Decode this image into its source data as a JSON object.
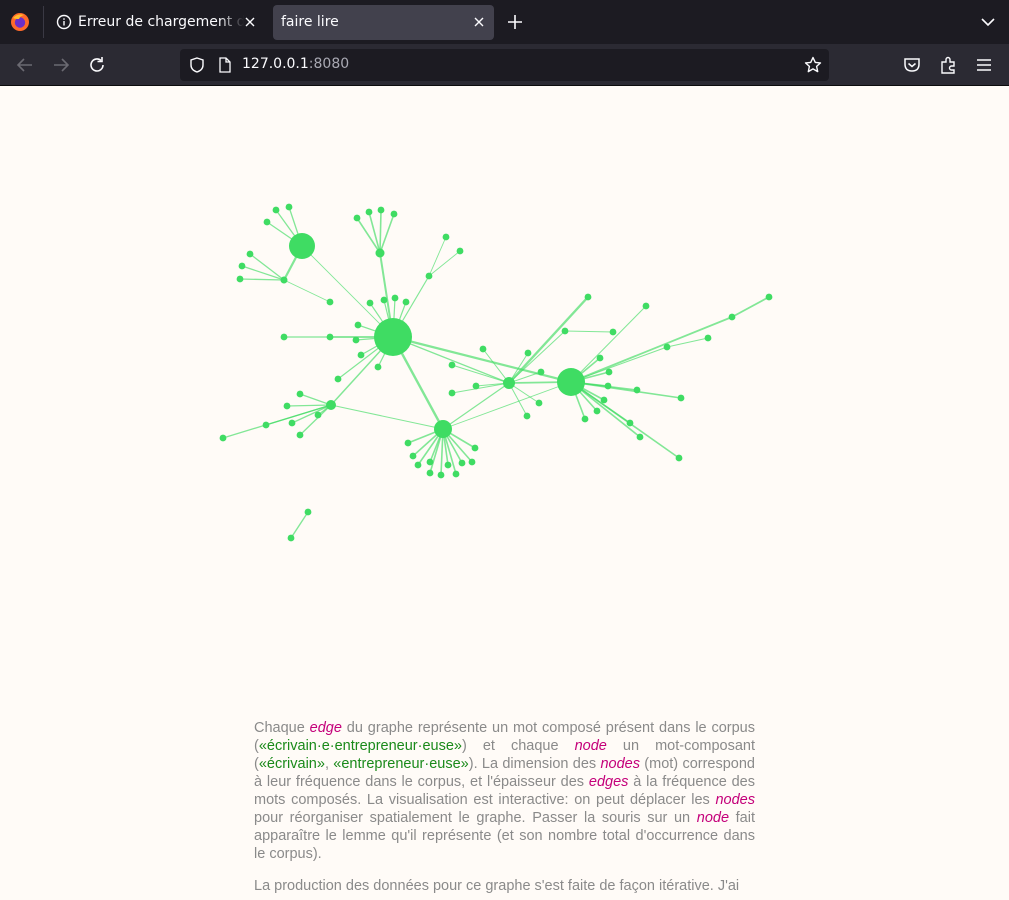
{
  "browser": {
    "tabs": [
      {
        "title": "Erreur de chargement de la page",
        "active": false
      },
      {
        "title": "faire lire",
        "active": true
      }
    ],
    "url_host": "127.0.0.1",
    "url_port": ":8080"
  },
  "colors": {
    "node": "#3fdc63",
    "edge": "#3fdc63",
    "emphasis": "#c4007a",
    "example": "#1a8a1a",
    "text": "#8a8a8a",
    "page_bg": "#fffbf7"
  },
  "description": {
    "p1": {
      "s1": "Chaque ",
      "edge": "edge",
      "s2": " du graphe représente un mot composé présent dans le corpus (",
      "ex1": "«écrivain·e·entrepreneur·euse»",
      "s3": ") et chaque ",
      "node": "node",
      "s4": " un mot-composant (",
      "ex2": "«écrivain»",
      "s5": ", ",
      "ex3": "«entrepreneur·euse»",
      "s6": "). La dimension des ",
      "nodes1": "nodes",
      "s7": " (mot) correspond à leur fréquence dans le corpus, et l'épaisseur des ",
      "edges": "edges",
      "s8": " à la fréquence des mots composés. La visualisation est interactive: on peut déplacer les ",
      "nodes2": "nodes",
      "s9": " pour réorganiser spatialement le graphe. Passer la souris sur un ",
      "node2": "node",
      "s10": " fait apparaître le lemme qu'il représente (et son nombre total d'occurrence dans le corpus)."
    },
    "p2": "La production des données pour ce graphe s'est faite de façon itérative. J'ai"
  }
}
